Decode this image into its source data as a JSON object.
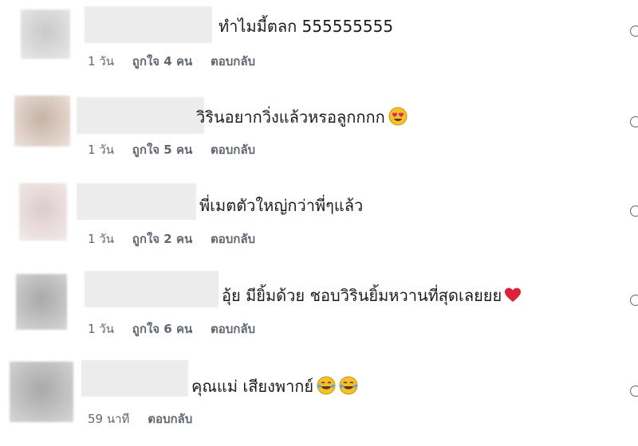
{
  "comments": [
    {
      "text": "ทำไมมี้ตลก 555555555",
      "time": "1 วัน",
      "likes": "ถูกใจ 4 คน",
      "reply": "ตอบกลับ",
      "emoji": []
    },
    {
      "text": "วิรินอยากวิ่งแล้วหรอลูกกกก",
      "time": "1 วัน",
      "likes": "ถูกใจ 5 คน",
      "reply": "ตอบกลับ",
      "emoji": [
        "heart-eyes-emoji"
      ]
    },
    {
      "text": "พี่เมตตัวใหญ่กว่าพี่ๆแล้ว",
      "time": "1 วัน",
      "likes": "ถูกใจ 2 คน",
      "reply": "ตอบกลับ",
      "emoji": []
    },
    {
      "text": "อุ้ย มียิ้มด้วย ชอบวิรินยิ้มหวานที่สุดเลยยย",
      "time": "1 วัน",
      "likes": "ถูกใจ 6 คน",
      "reply": "ตอบกลับ",
      "emoji": [
        "red-heart-emoji"
      ]
    },
    {
      "text": "คุณแม่ เสียงพากย์",
      "time": "59 นาที",
      "likes": "",
      "reply": "ตอบกลับ",
      "emoji": [
        "tears-of-joy-emoji",
        "grinning-sweat-emoji"
      ]
    }
  ],
  "colors": {
    "meta": "#606770",
    "text": "#1c1c1c",
    "blur": "#ececec"
  }
}
